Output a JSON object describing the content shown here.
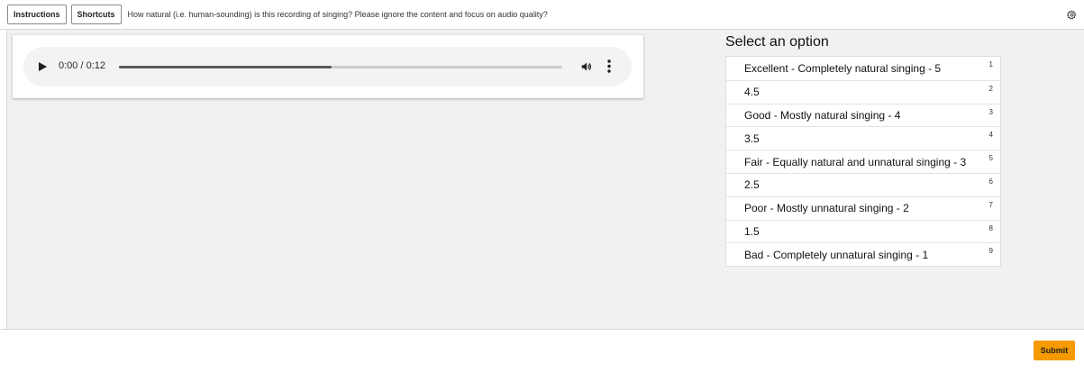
{
  "toolbar": {
    "instructions_label": "Instructions",
    "shortcuts_label": "Shortcuts",
    "question": "How natural (i.e. human-sounding) is this recording of singing? Please ignore the content and focus on audio quality?",
    "settings_icon": "gear-icon"
  },
  "audio": {
    "time": "0:00 / 0:12",
    "buffered_fraction": 0.48,
    "icons": {
      "play": "play-icon",
      "volume": "volume-icon",
      "menu": "more-vert-icon"
    }
  },
  "options": {
    "title": "Select an option",
    "items": [
      {
        "label": "Excellent - Completely natural singing - 5",
        "key": "1"
      },
      {
        "label": "4.5",
        "key": "2"
      },
      {
        "label": "Good - Mostly natural singing - 4",
        "key": "3"
      },
      {
        "label": "3.5",
        "key": "4"
      },
      {
        "label": "Fair - Equally natural and unnatural singing - 3",
        "key": "5"
      },
      {
        "label": "2.5",
        "key": "6"
      },
      {
        "label": "Poor - Mostly unnatural singing - 2",
        "key": "7"
      },
      {
        "label": "1.5",
        "key": "8"
      },
      {
        "label": "Bad - Completely unnatural singing - 1",
        "key": "9"
      }
    ]
  },
  "footer": {
    "submit_label": "Submit"
  },
  "colors": {
    "accent": "#f59a00",
    "workspace_bg": "#f0f2f0",
    "player_bg": "#f1f3f4"
  }
}
